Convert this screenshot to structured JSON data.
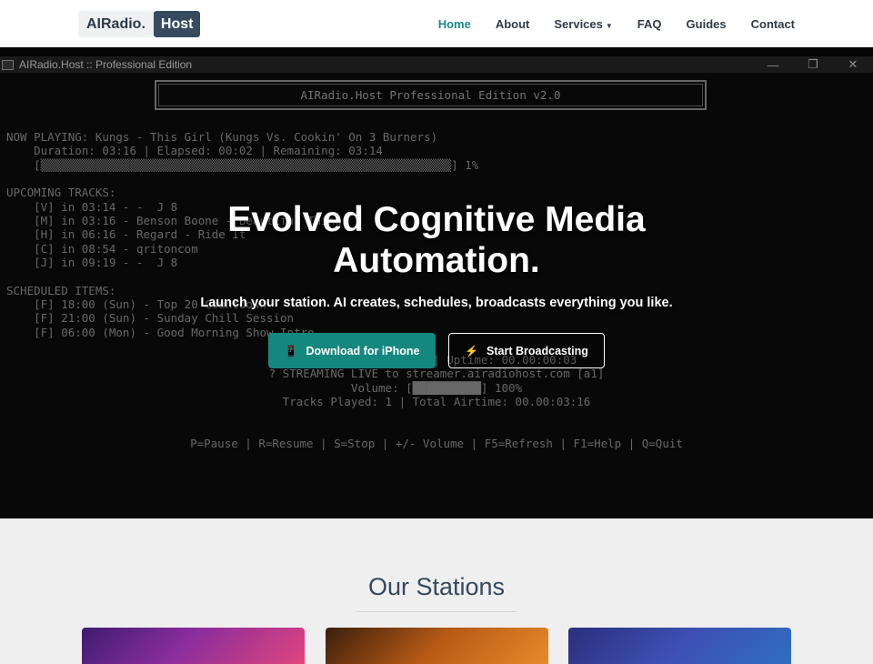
{
  "nav": {
    "logo_part1": "AIRadio.",
    "logo_part2": "Host",
    "links": [
      "Home",
      "About",
      "Services",
      "FAQ",
      "Guides",
      "Contact"
    ],
    "services_caret": "▼",
    "active_color": "#1d8a84"
  },
  "window": {
    "title": "AIRadio.Host :: Professional Edition",
    "minimize_glyph": "—",
    "restore_glyph": "❐",
    "close_glyph": "✕"
  },
  "console": {
    "banner": "AIRadio.Host Professional Edition v2.0",
    "now_playing": "NOW PLAYING: Kungs - This Girl (Kungs Vs. Cookin' On 3 Burners)",
    "timing": "    Duration: 03:16 | Elapsed: 00:02 | Remaining: 03:14",
    "progress": "    [▒▒▒▒▒▒▒▒▒▒▒▒▒▒▒▒▒▒▒▒▒▒▒▒▒▒▒▒▒▒▒▒▒▒▒▒▒▒▒▒▒▒▒▒▒▒▒▒▒▒▒▒▒▒▒▒▒▒▒▒] 1%",
    "progress_percent": 1,
    "upcoming_header": "UPCOMING TRACKS:",
    "upcoming": [
      "    [V] in 03:14 - -  J 8",
      "    [M] in 03:16 - Benson Boone - Beautiful Things",
      "    [H] in 06:16 - Regard - Ride It",
      "    [C] in 08:54 - qritoncom",
      "    [J] in 09:19 - -  J 8"
    ],
    "scheduled_header": "SCHEDULED ITEMS:",
    "scheduled": [
      "    [F] 18:00 (Sun) - Top 20 Countdown",
      "    [F] 21:00 (Sun) - Sunday Chill Session",
      "    [F] 06:00 (Mon) - Good Morning Show Intro"
    ],
    "status_lines": [
      "2025-01-26 14:58:52 | Uptime: 00.00:00:03",
      "? STREAMING LIVE to streamer.airadiohost.com [a1]",
      "Volume: [██████████] 100%",
      "Tracks Played: 1 | Total Airtime: 00.00:03:16"
    ],
    "volume_percent": 100,
    "controls": "P=Pause | R=Resume | S=Stop | +/- Volume | F5=Refresh | F1=Help | Q=Quit"
  },
  "hero": {
    "title": "Evolved Cognitive Media Automation.",
    "subtitle": "Launch your station. AI creates, schedules, broadcasts everything you like.",
    "primary_button": "Download for iPhone",
    "primary_icon": "📱",
    "secondary_button": "Start Broadcasting",
    "secondary_icon": "⚡",
    "primary_color": "#14877f"
  },
  "stations": {
    "heading": "Our Stations"
  }
}
